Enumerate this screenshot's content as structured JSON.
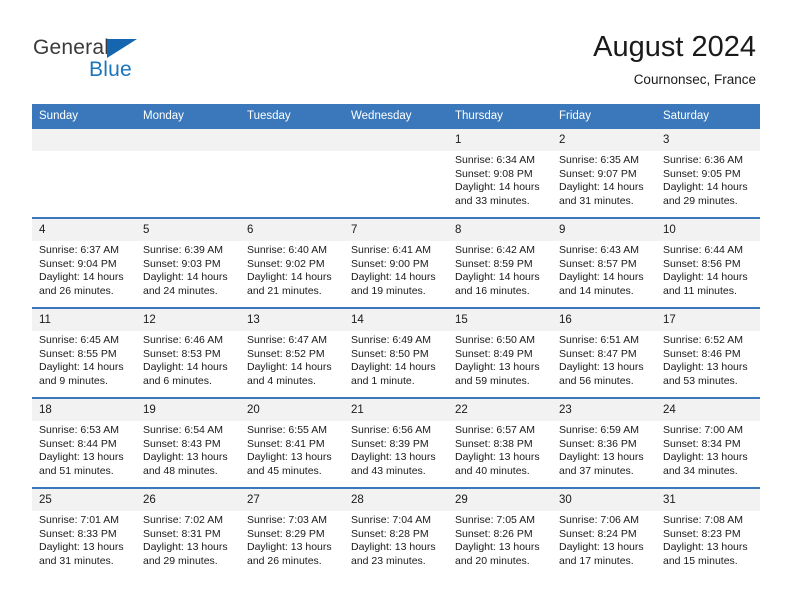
{
  "brand": {
    "name_top": "General",
    "name_bottom": "Blue",
    "triangle_color": "#1565b0",
    "blue_color": "#1b75bb"
  },
  "header": {
    "title": "August 2024",
    "location": "Cournonsec, France"
  },
  "theme": {
    "header_blue": "#3a78bb",
    "daynum_band": "#f2f2f2",
    "page_background": "#ffffff"
  },
  "weekday_headers": [
    "Sunday",
    "Monday",
    "Tuesday",
    "Wednesday",
    "Thursday",
    "Friday",
    "Saturday"
  ],
  "weeks": [
    [
      {
        "day": "",
        "blank": true
      },
      {
        "day": "",
        "blank": true
      },
      {
        "day": "",
        "blank": true
      },
      {
        "day": "",
        "blank": true
      },
      {
        "day": "1",
        "sunrise": "Sunrise: 6:34 AM",
        "sunset": "Sunset: 9:08 PM",
        "daylight_1": "Daylight: 14 hours",
        "daylight_2": "and 33 minutes."
      },
      {
        "day": "2",
        "sunrise": "Sunrise: 6:35 AM",
        "sunset": "Sunset: 9:07 PM",
        "daylight_1": "Daylight: 14 hours",
        "daylight_2": "and 31 minutes."
      },
      {
        "day": "3",
        "sunrise": "Sunrise: 6:36 AM",
        "sunset": "Sunset: 9:05 PM",
        "daylight_1": "Daylight: 14 hours",
        "daylight_2": "and 29 minutes."
      }
    ],
    [
      {
        "day": "4",
        "sunrise": "Sunrise: 6:37 AM",
        "sunset": "Sunset: 9:04 PM",
        "daylight_1": "Daylight: 14 hours",
        "daylight_2": "and 26 minutes."
      },
      {
        "day": "5",
        "sunrise": "Sunrise: 6:39 AM",
        "sunset": "Sunset: 9:03 PM",
        "daylight_1": "Daylight: 14 hours",
        "daylight_2": "and 24 minutes."
      },
      {
        "day": "6",
        "sunrise": "Sunrise: 6:40 AM",
        "sunset": "Sunset: 9:02 PM",
        "daylight_1": "Daylight: 14 hours",
        "daylight_2": "and 21 minutes."
      },
      {
        "day": "7",
        "sunrise": "Sunrise: 6:41 AM",
        "sunset": "Sunset: 9:00 PM",
        "daylight_1": "Daylight: 14 hours",
        "daylight_2": "and 19 minutes."
      },
      {
        "day": "8",
        "sunrise": "Sunrise: 6:42 AM",
        "sunset": "Sunset: 8:59 PM",
        "daylight_1": "Daylight: 14 hours",
        "daylight_2": "and 16 minutes."
      },
      {
        "day": "9",
        "sunrise": "Sunrise: 6:43 AM",
        "sunset": "Sunset: 8:57 PM",
        "daylight_1": "Daylight: 14 hours",
        "daylight_2": "and 14 minutes."
      },
      {
        "day": "10",
        "sunrise": "Sunrise: 6:44 AM",
        "sunset": "Sunset: 8:56 PM",
        "daylight_1": "Daylight: 14 hours",
        "daylight_2": "and 11 minutes."
      }
    ],
    [
      {
        "day": "11",
        "sunrise": "Sunrise: 6:45 AM",
        "sunset": "Sunset: 8:55 PM",
        "daylight_1": "Daylight: 14 hours",
        "daylight_2": "and 9 minutes."
      },
      {
        "day": "12",
        "sunrise": "Sunrise: 6:46 AM",
        "sunset": "Sunset: 8:53 PM",
        "daylight_1": "Daylight: 14 hours",
        "daylight_2": "and 6 minutes."
      },
      {
        "day": "13",
        "sunrise": "Sunrise: 6:47 AM",
        "sunset": "Sunset: 8:52 PM",
        "daylight_1": "Daylight: 14 hours",
        "daylight_2": "and 4 minutes."
      },
      {
        "day": "14",
        "sunrise": "Sunrise: 6:49 AM",
        "sunset": "Sunset: 8:50 PM",
        "daylight_1": "Daylight: 14 hours",
        "daylight_2": "and 1 minute."
      },
      {
        "day": "15",
        "sunrise": "Sunrise: 6:50 AM",
        "sunset": "Sunset: 8:49 PM",
        "daylight_1": "Daylight: 13 hours",
        "daylight_2": "and 59 minutes."
      },
      {
        "day": "16",
        "sunrise": "Sunrise: 6:51 AM",
        "sunset": "Sunset: 8:47 PM",
        "daylight_1": "Daylight: 13 hours",
        "daylight_2": "and 56 minutes."
      },
      {
        "day": "17",
        "sunrise": "Sunrise: 6:52 AM",
        "sunset": "Sunset: 8:46 PM",
        "daylight_1": "Daylight: 13 hours",
        "daylight_2": "and 53 minutes."
      }
    ],
    [
      {
        "day": "18",
        "sunrise": "Sunrise: 6:53 AM",
        "sunset": "Sunset: 8:44 PM",
        "daylight_1": "Daylight: 13 hours",
        "daylight_2": "and 51 minutes."
      },
      {
        "day": "19",
        "sunrise": "Sunrise: 6:54 AM",
        "sunset": "Sunset: 8:43 PM",
        "daylight_1": "Daylight: 13 hours",
        "daylight_2": "and 48 minutes."
      },
      {
        "day": "20",
        "sunrise": "Sunrise: 6:55 AM",
        "sunset": "Sunset: 8:41 PM",
        "daylight_1": "Daylight: 13 hours",
        "daylight_2": "and 45 minutes."
      },
      {
        "day": "21",
        "sunrise": "Sunrise: 6:56 AM",
        "sunset": "Sunset: 8:39 PM",
        "daylight_1": "Daylight: 13 hours",
        "daylight_2": "and 43 minutes."
      },
      {
        "day": "22",
        "sunrise": "Sunrise: 6:57 AM",
        "sunset": "Sunset: 8:38 PM",
        "daylight_1": "Daylight: 13 hours",
        "daylight_2": "and 40 minutes."
      },
      {
        "day": "23",
        "sunrise": "Sunrise: 6:59 AM",
        "sunset": "Sunset: 8:36 PM",
        "daylight_1": "Daylight: 13 hours",
        "daylight_2": "and 37 minutes."
      },
      {
        "day": "24",
        "sunrise": "Sunrise: 7:00 AM",
        "sunset": "Sunset: 8:34 PM",
        "daylight_1": "Daylight: 13 hours",
        "daylight_2": "and 34 minutes."
      }
    ],
    [
      {
        "day": "25",
        "sunrise": "Sunrise: 7:01 AM",
        "sunset": "Sunset: 8:33 PM",
        "daylight_1": "Daylight: 13 hours",
        "daylight_2": "and 31 minutes."
      },
      {
        "day": "26",
        "sunrise": "Sunrise: 7:02 AM",
        "sunset": "Sunset: 8:31 PM",
        "daylight_1": "Daylight: 13 hours",
        "daylight_2": "and 29 minutes."
      },
      {
        "day": "27",
        "sunrise": "Sunrise: 7:03 AM",
        "sunset": "Sunset: 8:29 PM",
        "daylight_1": "Daylight: 13 hours",
        "daylight_2": "and 26 minutes."
      },
      {
        "day": "28",
        "sunrise": "Sunrise: 7:04 AM",
        "sunset": "Sunset: 8:28 PM",
        "daylight_1": "Daylight: 13 hours",
        "daylight_2": "and 23 minutes."
      },
      {
        "day": "29",
        "sunrise": "Sunrise: 7:05 AM",
        "sunset": "Sunset: 8:26 PM",
        "daylight_1": "Daylight: 13 hours",
        "daylight_2": "and 20 minutes."
      },
      {
        "day": "30",
        "sunrise": "Sunrise: 7:06 AM",
        "sunset": "Sunset: 8:24 PM",
        "daylight_1": "Daylight: 13 hours",
        "daylight_2": "and 17 minutes."
      },
      {
        "day": "31",
        "sunrise": "Sunrise: 7:08 AM",
        "sunset": "Sunset: 8:23 PM",
        "daylight_1": "Daylight: 13 hours",
        "daylight_2": "and 15 minutes."
      }
    ]
  ]
}
